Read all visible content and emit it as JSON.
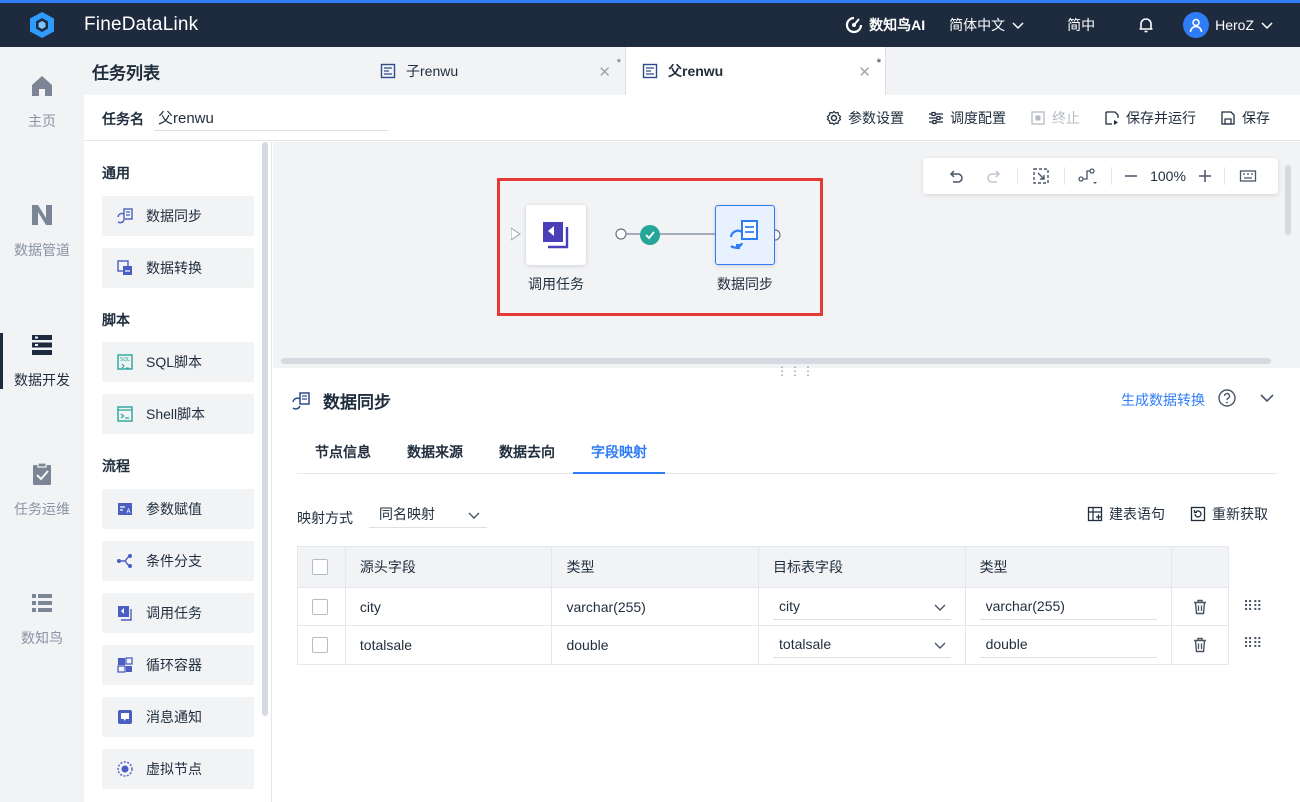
{
  "app": {
    "title": "FineDataLink"
  },
  "topbar": {
    "ai_label": "数知鸟AI",
    "language": "简体中文",
    "locale": "简中",
    "user": "HeroZ"
  },
  "leftnav": {
    "items": [
      {
        "label": "主页",
        "icon": "home-icon"
      },
      {
        "label": "数据管道",
        "icon": "pipeline-icon"
      },
      {
        "label": "数据开发",
        "icon": "dev-icon",
        "active": true
      },
      {
        "label": "任务运维",
        "icon": "ops-clipboard-icon"
      },
      {
        "label": "数知鸟",
        "icon": "list-icon"
      }
    ]
  },
  "tasklist": {
    "title": "任务列表"
  },
  "tabs": [
    {
      "label": "子renwu",
      "modified": "*"
    },
    {
      "label": "父renwu",
      "modified": "*",
      "active": true
    }
  ],
  "task": {
    "name_label": "任务名",
    "name_value": "父renwu"
  },
  "toolbar": {
    "params": "参数设置",
    "schedule": "调度配置",
    "stop": "终止",
    "save_run": "保存并运行",
    "save": "保存"
  },
  "palette": {
    "groups": [
      {
        "label": "通用",
        "items": [
          "数据同步",
          "数据转换"
        ]
      },
      {
        "label": "脚本",
        "items": [
          "SQL脚本",
          "Shell脚本"
        ]
      },
      {
        "label": "流程",
        "items": [
          "参数赋值",
          "条件分支",
          "调用任务",
          "循环容器",
          "消息通知",
          "虚拟节点"
        ]
      }
    ]
  },
  "canvas": {
    "zoom": "100%",
    "nodes": [
      {
        "label": "调用任务"
      },
      {
        "label": "数据同步"
      }
    ]
  },
  "panel": {
    "title": "数据同步",
    "link": "生成数据转换",
    "tabs": [
      "节点信息",
      "数据来源",
      "数据去向",
      "字段映射"
    ],
    "active_tab": "字段映射",
    "mapping_label": "映射方式",
    "mapping_value": "同名映射",
    "create_stmt": "建表语句",
    "refetch": "重新获取",
    "table": {
      "headers": [
        "源头字段",
        "类型",
        "目标表字段",
        "类型"
      ],
      "rows": [
        {
          "src": "city",
          "src_type": "varchar(255)",
          "dst": "city",
          "dst_type": "varchar(255)"
        },
        {
          "src": "totalsale",
          "src_type": "double",
          "dst": "totalsale",
          "dst_type": "double"
        }
      ]
    }
  },
  "colors": {
    "topbar_bg": "#1e2b3e",
    "accent": "#2f7df6",
    "highlight": "#e53935",
    "success": "#26a69a"
  }
}
